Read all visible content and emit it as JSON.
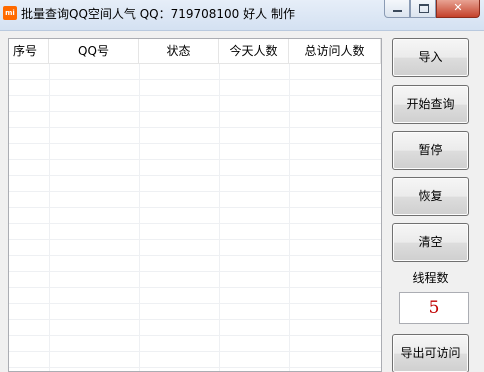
{
  "window": {
    "title": "批量查询QQ空间人气  QQ：719708100 好人 制作",
    "icon_label": "mi"
  },
  "list": {
    "columns": [
      "序号",
      "QQ号",
      "状态",
      "今天人数",
      "总访问人数"
    ],
    "rows": []
  },
  "buttons": {
    "import": "导入",
    "start": "开始查询",
    "pause": "暂停",
    "resume": "恢复",
    "clear": "清空",
    "export": "导出可访问"
  },
  "threads": {
    "label": "线程数",
    "value": "5"
  },
  "colors": {
    "thread_value": "#c00000",
    "close_button": "#c4412a"
  }
}
